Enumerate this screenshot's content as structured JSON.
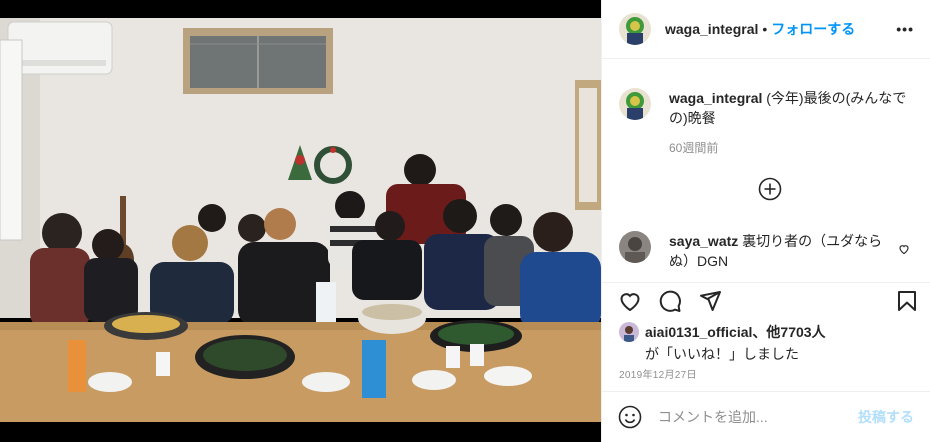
{
  "post": {
    "author": "waga_integral",
    "dot": "•",
    "follow_label": "フォローする",
    "more_label": "•••",
    "caption": {
      "username": "waga_integral",
      "text": "(今年)最後の(みんなでの)晩餐"
    },
    "time_ago": "60週間前",
    "comments": [
      {
        "username": "saya_watz",
        "text": "裏切り者の（ユダならぬ）DGN"
      }
    ],
    "likes": {
      "user": "aiai0131_official",
      "others": "、他7703人",
      "suffix": "が「いいね！」しました"
    },
    "date": "2019年12月27日",
    "add_comment": {
      "placeholder": "コメントを追加...",
      "post_label": "投稿する"
    }
  },
  "icons": {
    "more": "ellipsis-icon",
    "load_more": "plus-circle-icon",
    "like": "heart-icon",
    "comment": "comment-icon",
    "share": "paper-plane-icon",
    "save": "bookmark-icon",
    "emoji": "smiley-icon"
  },
  "colors": {
    "link": "#0095f6",
    "post_disabled": "#b2dffc",
    "muted": "#8e8e8e",
    "text": "#262626"
  }
}
